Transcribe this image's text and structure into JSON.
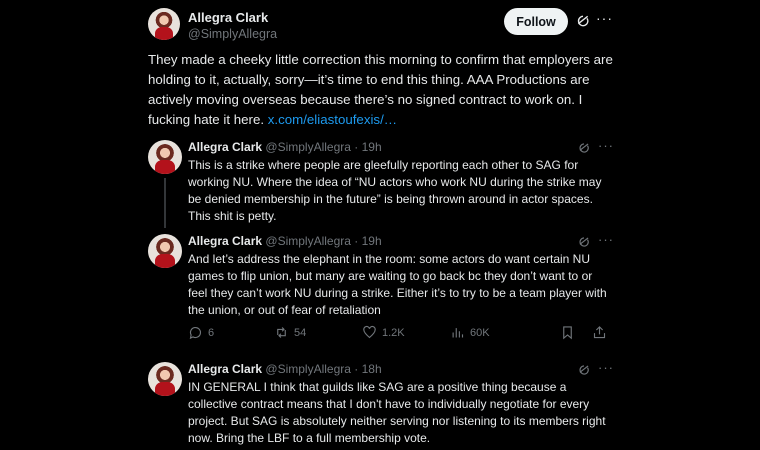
{
  "main_tweet": {
    "name": "Allegra Clark",
    "handle": "@SimplyAllegra",
    "follow_label": "Follow",
    "text": "They made a cheeky little correction this morning to confirm that employers are holding to it, actually, sorry—it’s time to end this thing. AAA Productions are actively moving overseas because there’s no signed contract to work on. I fucking hate it here. ",
    "link": "x.com/eliastoufexis/…"
  },
  "replies": [
    {
      "name": "Allegra Clark",
      "meta": "@SimplyAllegra · 19h",
      "text": "This is a strike where people are gleefully reporting each other to SAG for working NU. Where the idea of “NU actors who work NU during the strike may be denied membership in the future” is being thrown around in actor spaces. This shit is petty."
    },
    {
      "name": "Allegra Clark",
      "meta": "@SimplyAllegra · 19h",
      "text": "And let’s address the elephant in the room: some actors do want certain NU games to flip union, but many are waiting to go back bc they don’t want to or feel they can’t work NU during a strike. Either it’s to try to be a team player with the union, or out of fear of retaliation",
      "stats": {
        "replies": "6",
        "reposts": "54",
        "likes": "1.2K",
        "views": "60K"
      }
    },
    {
      "name": "Allegra Clark",
      "meta": "@SimplyAllegra · 18h",
      "text": "IN GENERAL I think that guilds like SAG are a positive thing because a collective contract means that I don't have to individually negotiate for every project. But SAG is absolutely neither serving nor listening to its members right now. Bring the LBF to a full membership vote."
    }
  ],
  "icons": {
    "more": "more-icon",
    "grok": "grok-icon",
    "reply": "reply-icon",
    "repost": "repost-icon",
    "like": "heart-icon",
    "views": "views-icon",
    "bookmark": "bookmark-icon",
    "share": "share-icon"
  },
  "colors": {
    "background": "#000000",
    "link": "#1d9bf0",
    "muted": "#71767b",
    "text": "#e7e9ea",
    "follow_bg": "#eff3f4"
  }
}
